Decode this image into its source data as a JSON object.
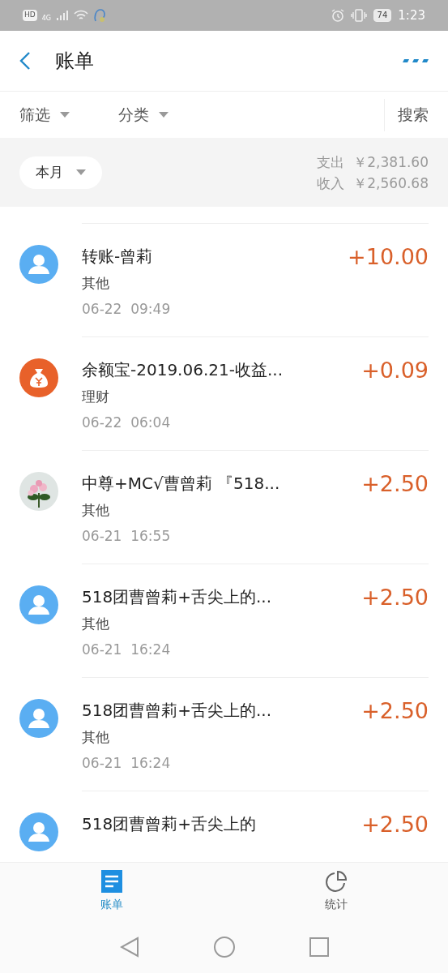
{
  "status_bar": {
    "time": "1:23",
    "battery": "74",
    "network": "4G",
    "hd": "HD"
  },
  "header": {
    "title": "账单"
  },
  "filters": [
    {
      "label": "筛选"
    },
    {
      "label": "分类"
    }
  ],
  "search": {
    "label": "搜索"
  },
  "summary": {
    "period": "本月",
    "expense_label": "支出",
    "expense": "￥2,381.60",
    "income_label": "收入",
    "income": "￥2,560.68"
  },
  "transactions": [
    {
      "kind": "person",
      "title": "转账-曾莉",
      "category": "其他",
      "date": "06-22",
      "time": "09:49",
      "amount": "+10.00"
    },
    {
      "kind": "money",
      "title": "余额宝-2019.06.21-收益...",
      "category": "理财",
      "date": "06-22",
      "time": "06:04",
      "amount": "+0.09"
    },
    {
      "kind": "picture",
      "title": "中尊+MC√曹曾莉 『518...",
      "category": "其他",
      "date": "06-21",
      "time": "16:55",
      "amount": "+2.50"
    },
    {
      "kind": "person",
      "title": "518团曹曾莉+舌尖上的...",
      "category": "其他",
      "date": "06-21",
      "time": "16:24",
      "amount": "+2.50"
    },
    {
      "kind": "person",
      "title": "518团曹曾莉+舌尖上的...",
      "category": "其他",
      "date": "06-21",
      "time": "16:24",
      "amount": "+2.50"
    },
    {
      "kind": "person",
      "title": "518团曹曾莉+舌尖上的",
      "amount": "+2.50"
    }
  ],
  "tabs": [
    {
      "kind": "list",
      "label": "账单",
      "selected": true
    },
    {
      "kind": "chart",
      "label": "统计",
      "selected": false
    }
  ]
}
